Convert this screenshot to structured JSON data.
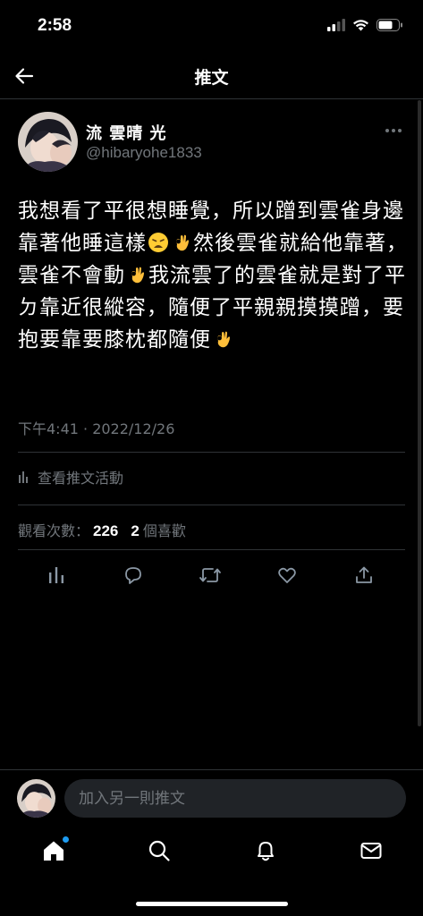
{
  "status_bar": {
    "time": "2:58"
  },
  "nav": {
    "title": "推文",
    "back_icon": "arrow-left-icon"
  },
  "tweet": {
    "display_name": "流 雲晴 光",
    "handle": "@hibaryohe1833",
    "text_segments": [
      "我想看了平很想睡覺，所以蹭到雲雀身邊靠著他睡這樣",
      "然後雲雀就給他靠著，雲雀不會動",
      "我流雲了的雲雀就是對了平ㄉ靠近很縱容，隨便了平親親摸摸蹭，要抱要靠要膝枕都隨便"
    ],
    "emojis": [
      "weary-face",
      "ok-hand",
      "ok-hand",
      "ok-hand"
    ],
    "timestamp": "下午4:41 · 2022/12/26",
    "activity_label": "查看推文活動",
    "views_label": "觀看次數：",
    "views_count": "226",
    "likes_count": "2",
    "likes_label": "個喜歡"
  },
  "actions": [
    "analytics-icon",
    "reply-icon",
    "retweet-icon",
    "like-icon",
    "share-icon"
  ],
  "reply": {
    "placeholder": "加入另一則推文"
  },
  "tabs": [
    "home-icon",
    "search-icon",
    "notifications-icon",
    "messages-icon"
  ],
  "colors": {
    "background": "#000000",
    "accent": "#1d9bf0",
    "muted": "#71767b",
    "text": "#e7e9ea"
  }
}
